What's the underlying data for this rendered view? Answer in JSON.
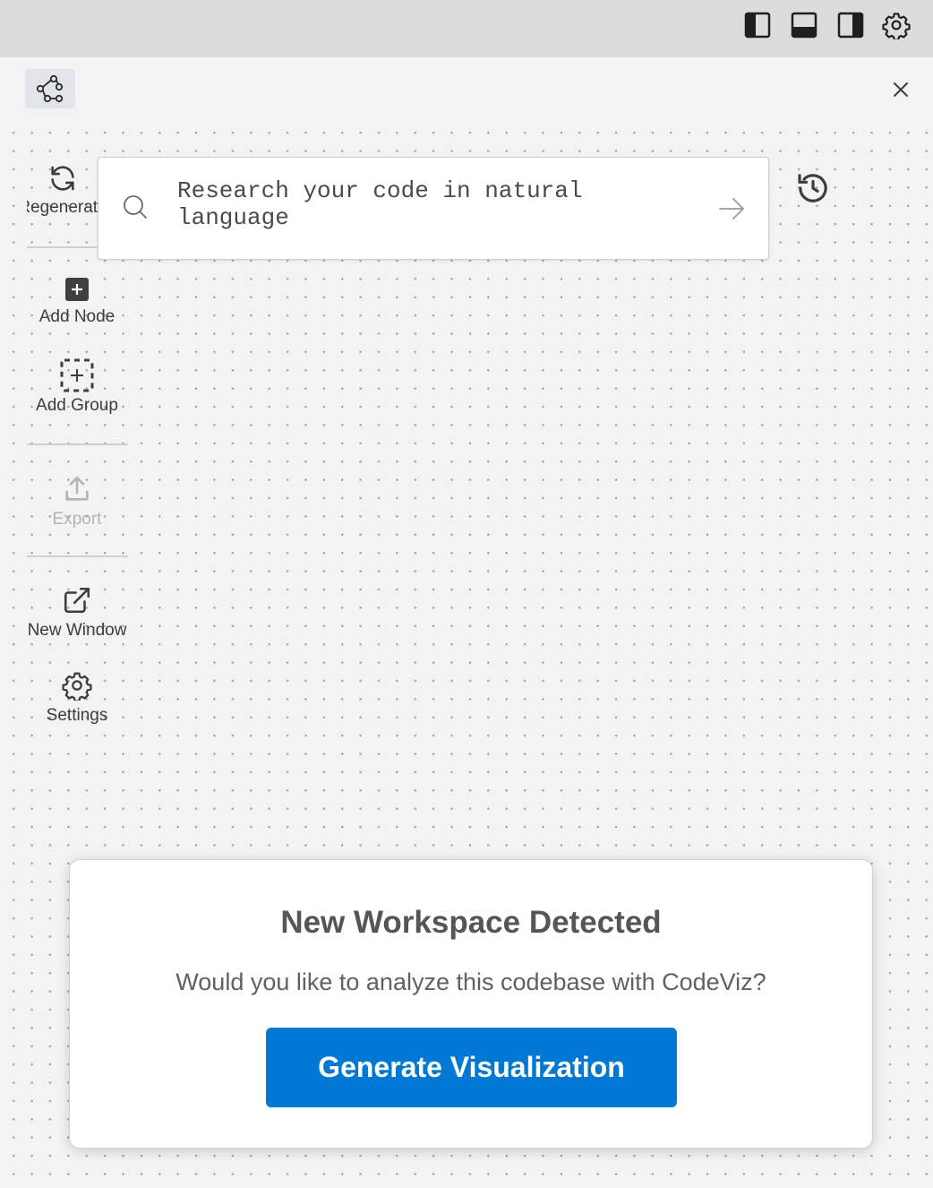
{
  "titlebar": {
    "icons": [
      "sidebar-left-icon",
      "panel-bottom-icon",
      "sidebar-right-icon",
      "gear-icon"
    ]
  },
  "header": {
    "logo_icon": "graph-nodes-icon",
    "close_icon": "close-icon"
  },
  "toolbar": {
    "regenerate_label": "Regenerate",
    "add_node_label": "Add Node",
    "add_group_label": "Add Group",
    "export_label": "Export",
    "new_window_label": "New Window",
    "settings_label": "Settings"
  },
  "search": {
    "placeholder": "Research your code in natural language",
    "value": ""
  },
  "dialog": {
    "title": "New Workspace Detected",
    "message": "Would you like to analyze this codebase with CodeViz?",
    "button_label": "Generate Visualization"
  },
  "colors": {
    "accent": "#0078d4",
    "titlebar": "#dcdcdc",
    "canvas": "#f3f3f3",
    "dot": "#9a9a9a"
  }
}
